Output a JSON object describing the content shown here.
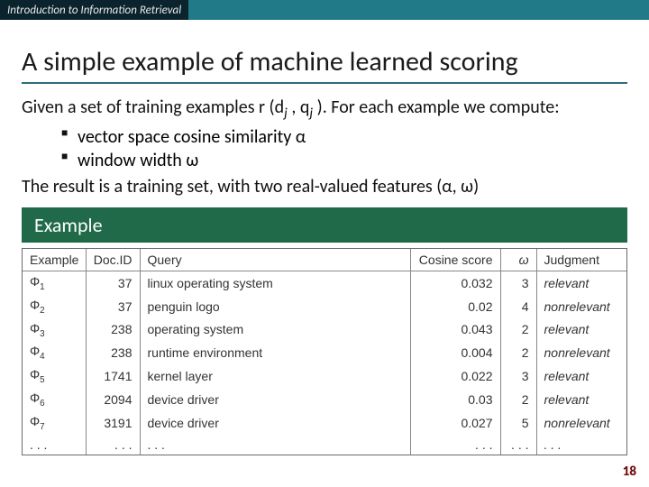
{
  "topbar": {
    "label": "Introduction to Information Retrieval"
  },
  "title": "A simple example of machine learned scoring",
  "body": {
    "line1_a": "Given a set of training examples r (d",
    "line1_sub1": "j",
    "line1_b": " , q",
    "line1_sub2": "j",
    "line1_c": " ). For each example we compute:",
    "bullet1": "vector space cosine similarity α",
    "bullet2": "window width ω",
    "line2": "The result is a training set, with two real-valued features (α, ω)"
  },
  "example_label": "Example",
  "table": {
    "headers": {
      "example": "Example",
      "docid": "Doc.ID",
      "query": "Query",
      "cos": "Cosine score",
      "omega": "ω",
      "judg": "Judgment"
    },
    "rows": [
      {
        "phi": "Φ",
        "idx": "1",
        "docid": "37",
        "query": "linux operating system",
        "cos": "0.032",
        "omega": "3",
        "judg": "relevant"
      },
      {
        "phi": "Φ",
        "idx": "2",
        "docid": "37",
        "query": "penguin logo",
        "cos": "0.02",
        "omega": "4",
        "judg": "nonrelevant"
      },
      {
        "phi": "Φ",
        "idx": "3",
        "docid": "238",
        "query": "operating system",
        "cos": "0.043",
        "omega": "2",
        "judg": "relevant"
      },
      {
        "phi": "Φ",
        "idx": "4",
        "docid": "238",
        "query": "runtime environment",
        "cos": "0.004",
        "omega": "2",
        "judg": "nonrelevant"
      },
      {
        "phi": "Φ",
        "idx": "5",
        "docid": "1741",
        "query": "kernel layer",
        "cos": "0.022",
        "omega": "3",
        "judg": "relevant"
      },
      {
        "phi": "Φ",
        "idx": "6",
        "docid": "2094",
        "query": "device driver",
        "cos": "0.03",
        "omega": "2",
        "judg": "relevant"
      },
      {
        "phi": "Φ",
        "idx": "7",
        "docid": "3191",
        "query": "device driver",
        "cos": "0.027",
        "omega": "5",
        "judg": "nonrelevant"
      },
      {
        "phi": ". . .",
        "idx": "",
        "docid": ". . .",
        "query": ". . .",
        "cos": ". . .",
        "omega": ". . .",
        "judg": ". . ."
      }
    ]
  },
  "slide_number": "18"
}
